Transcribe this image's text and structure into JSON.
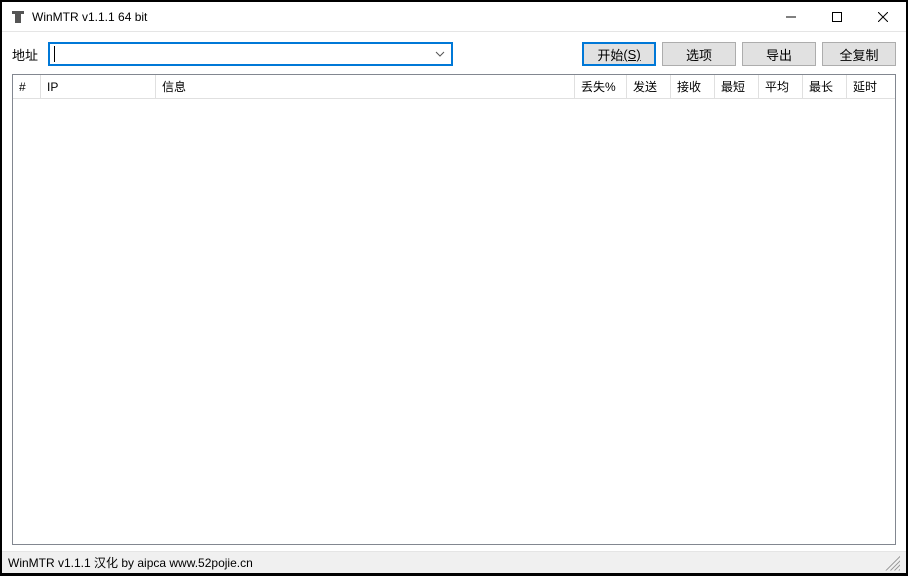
{
  "window": {
    "title": "WinMTR v1.1.1 64 bit"
  },
  "toolbar": {
    "address_label": "地址",
    "address_value": "",
    "start_label_pre": "开始",
    "start_label_key": "(S)",
    "options_label": "选项",
    "export_label": "导出",
    "copyall_label": "全复制"
  },
  "columns": {
    "hash": "#",
    "ip": "IP",
    "info": "信息",
    "loss": "丢失%",
    "sent": "发送",
    "recv": "接收",
    "best": "最短",
    "avg": "平均",
    "worst": "最长",
    "last": "延时"
  },
  "status": {
    "text": "WinMTR v1.1.1 汉化 by aipca www.52pojie.cn"
  }
}
